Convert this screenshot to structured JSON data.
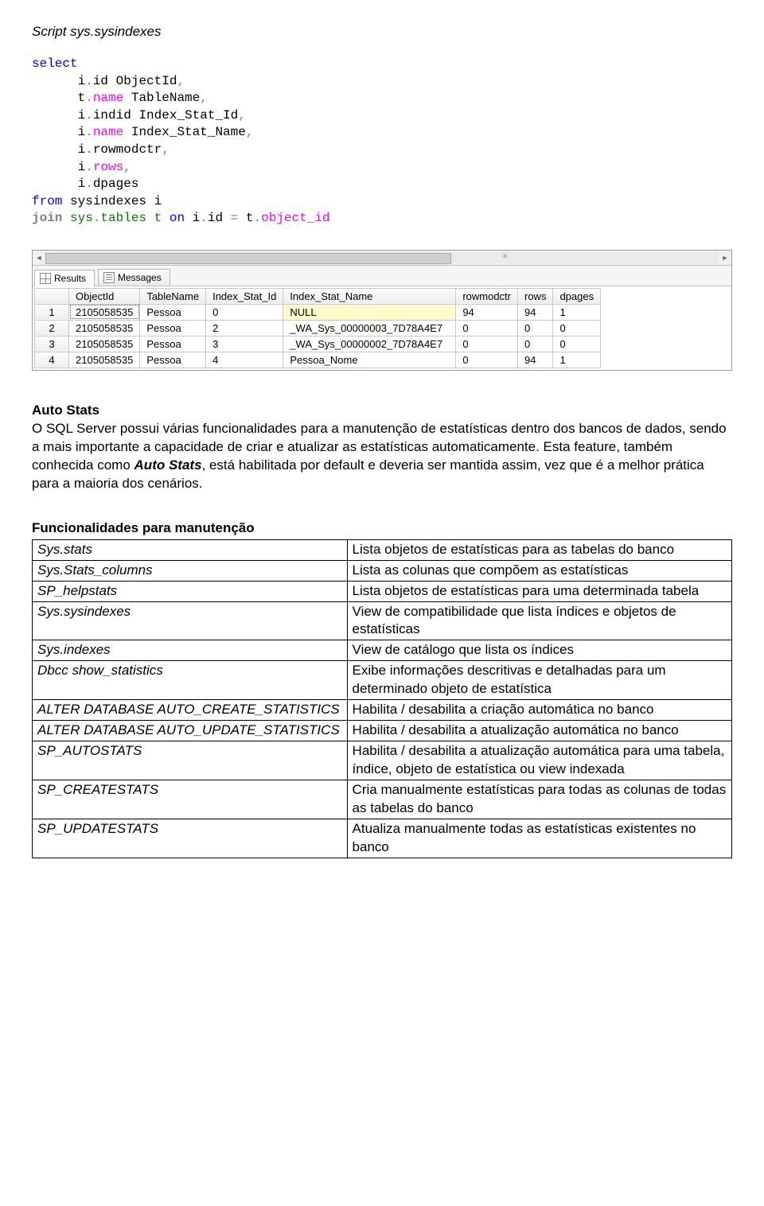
{
  "script_title": "Script sys.sysindexes",
  "sql": {
    "select": "select",
    "l1a": "i",
    "l1b": ".",
    "l1c": "id ObjectId",
    "l1d": ",",
    "l2a": "t",
    "l2b": ".",
    "l2c": "name",
    "l2d": " TableName",
    "l2e": ",",
    "l3a": "i",
    "l3b": ".",
    "l3c": "indid Index_Stat_Id",
    "l3d": ",",
    "l4a": "i",
    "l4b": ".",
    "l4c": "name",
    "l4d": " Index_Stat_Name",
    "l4e": ",",
    "l5a": "i",
    "l5b": ".",
    "l5c": "rowmodctr",
    "l5d": ",",
    "l6a": "i",
    "l6b": ".",
    "l6c": "rows",
    "l6d": ",",
    "l7a": "i",
    "l7b": ".",
    "l7c": "dpages",
    "from": "from",
    "from_tbl": " sysindexes i",
    "join": "join",
    "join_sys": " sys",
    "join_dot": ".",
    "join_tbl": "tables t ",
    "on": "on",
    "on_lhs": " i",
    "on_dot": ".",
    "on_id": "id ",
    "eq": "=",
    "on_rhs": " t",
    "on_dot2": ".",
    "on_obj": "object_id"
  },
  "tabs": {
    "results": "Results",
    "messages": "Messages"
  },
  "headers": {
    "c0": "",
    "c1": "ObjectId",
    "c2": "TableName",
    "c3": "Index_Stat_Id",
    "c4": "Index_Stat_Name",
    "c5": "rowmodctr",
    "c6": "rows",
    "c7": "dpages"
  },
  "rows": [
    {
      "n": "1",
      "c1": "2105058535",
      "c2": "Pessoa",
      "c3": "0",
      "c4": "NULL",
      "c5": "94",
      "c6": "94",
      "c7": "1",
      "null": true
    },
    {
      "n": "2",
      "c1": "2105058535",
      "c2": "Pessoa",
      "c3": "2",
      "c4": "_WA_Sys_00000003_7D78A4E7",
      "c5": "0",
      "c6": "0",
      "c7": "0"
    },
    {
      "n": "3",
      "c1": "2105058535",
      "c2": "Pessoa",
      "c3": "3",
      "c4": "_WA_Sys_00000002_7D78A4E7",
      "c5": "0",
      "c6": "0",
      "c7": "0"
    },
    {
      "n": "4",
      "c1": "2105058535",
      "c2": "Pessoa",
      "c3": "4",
      "c4": "Pessoa_Nome",
      "c5": "0",
      "c6": "94",
      "c7": "1"
    }
  ],
  "autostats": {
    "title": "Auto Stats",
    "p_before": "O SQL Server possui várias funcionalidades para a manutenção de estatísticas dentro dos bancos de dados, sendo a mais importante a capacidade de criar e atualizar as estatísticas automaticamente. Esta feature, também conhecida como ",
    "p_bold": "Auto Stats",
    "p_after": ", está habilitada por default e deveria ser mantida assim, vez que é a melhor prática para a maioria dos cenários."
  },
  "func_title": "Funcionalidades para manutenção",
  "func": [
    {
      "l": "Sys.stats",
      "r": "Lista objetos de estatísticas para as tabelas do banco",
      "ital": true
    },
    {
      "l": "Sys.Stats_columns",
      "r": "Lista as colunas que compõem as estatísticas",
      "ital": true
    },
    {
      "l": "SP_helpstats",
      "r": "Lista objetos de estatísticas para uma determinada tabela",
      "ital": true
    },
    {
      "l": "Sys.sysindexes",
      "r": "View de compatibilidade que lista índices e objetos de estatísticas",
      "ital": true
    },
    {
      "l": "Sys.indexes",
      "r": "View de catálogo que lista os índices",
      "ital": true
    },
    {
      "l": "Dbcc show_statistics",
      "r": "Exibe informações descritivas e detalhadas para um determinado objeto de estatística",
      "ital": true
    },
    {
      "l": "ALTER DATABASE AUTO_CREATE_STATISTICS",
      "r": "Habilita / desabilita a criação automática no banco",
      "ital": true
    },
    {
      "l": "ALTER DATABASE AUTO_UPDATE_STATISTICS",
      "r": "Habilita / desabilita a atualização automática no banco",
      "ital": true
    },
    {
      "l": "SP_AUTOSTATS",
      "r": "Habilita / desabilita a atualização automática para uma tabela, índice, objeto de estatística ou view indexada",
      "ital": true
    },
    {
      "l": "SP_CREATESTATS",
      "r": "Cria manualmente estatísticas para todas as colunas de todas as tabelas do banco",
      "ital": true
    },
    {
      "l": "SP_UPDATESTATS",
      "r": "Atualiza manualmente todas as estatísticas existentes no banco",
      "ital": true
    }
  ]
}
